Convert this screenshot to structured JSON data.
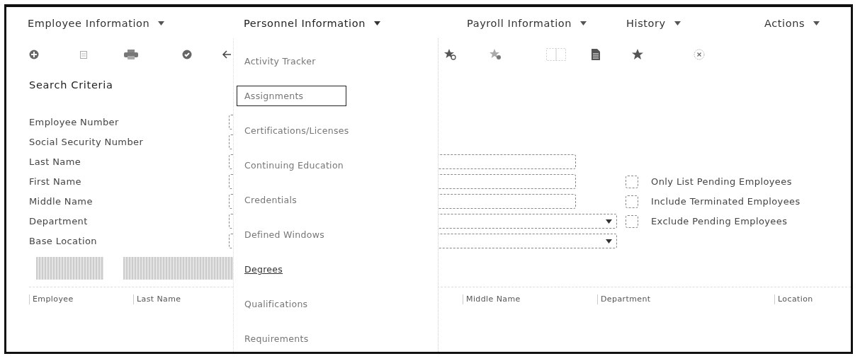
{
  "menu_bar": [
    {
      "label": "Employee Information",
      "expanded": false
    },
    {
      "label": "Personnel Information",
      "expanded": true
    },
    {
      "label": "Payroll Information",
      "expanded": false
    },
    {
      "label": "History",
      "expanded": false
    },
    {
      "label": "Actions",
      "expanded": false
    }
  ],
  "personnel_menu": [
    {
      "label": "Activity Tracker",
      "selected": false,
      "hovered": false
    },
    {
      "label": "Assignments",
      "selected": true,
      "hovered": false
    },
    {
      "label": "Certifications/Licenses",
      "selected": false,
      "hovered": false
    },
    {
      "label": "Continuing Education",
      "selected": false,
      "hovered": false
    },
    {
      "label": "Credentials",
      "selected": false,
      "hovered": false
    },
    {
      "label": "Defined Windows",
      "selected": false,
      "hovered": false
    },
    {
      "label": "Degrees",
      "selected": false,
      "hovered": true
    },
    {
      "label": "Qualifications",
      "selected": false,
      "hovered": false
    },
    {
      "label": "Requirements",
      "selected": false,
      "hovered": false
    }
  ],
  "search_criteria": {
    "title": "Search Criteria",
    "fields": [
      {
        "label": "Employee Number",
        "kind": "short"
      },
      {
        "label": "Social Security Number",
        "kind": "short"
      },
      {
        "label": "Last Name",
        "kind": "text"
      },
      {
        "label": "First Name",
        "kind": "text"
      },
      {
        "label": "Middle Name",
        "kind": "text"
      },
      {
        "label": "Department",
        "kind": "select"
      },
      {
        "label": "Base Location",
        "kind": "select"
      }
    ],
    "options": [
      {
        "label": "Only List Pending Employees",
        "checked": false
      },
      {
        "label": "Include Terminated Employees",
        "checked": false
      },
      {
        "label": "Exclude Pending Employees",
        "checked": false
      }
    ]
  },
  "table": {
    "columns": [
      "Employee",
      "Last Name",
      "Middle Name",
      "Department",
      "Location"
    ]
  }
}
